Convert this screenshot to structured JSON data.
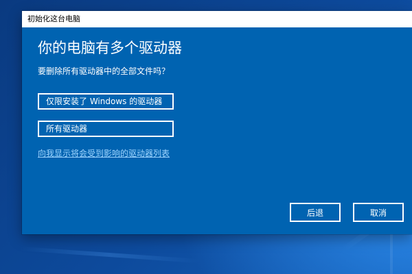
{
  "window": {
    "title": "初始化这台电脑"
  },
  "dialog": {
    "heading": "你的电脑有多个驱动器",
    "question": "要删除所有驱动器中的全部文件吗？",
    "options": [
      {
        "label": "仅限安装了 Windows 的驱动器"
      },
      {
        "label": "所有驱动器"
      }
    ],
    "link_text": "向我显示将会受到影响的驱动器列表",
    "back_label": "后退",
    "cancel_label": "取消"
  },
  "colors": {
    "dialog_background": "#0063b1",
    "titlebar_background": "#ffffff",
    "link_color": "#9fd4ff",
    "text_color": "#ffffff"
  }
}
